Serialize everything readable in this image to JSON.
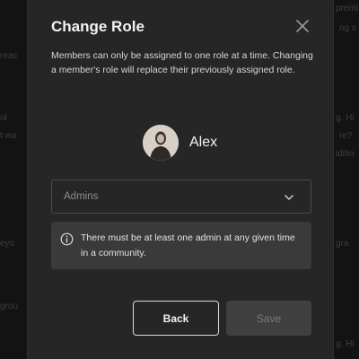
{
  "background": {
    "fragments": [
      {
        "text": "premi",
        "side": "right"
      },
      {
        "text": "ng s",
        "side": "right"
      },
      {
        "text": "reac",
        "side": "left"
      },
      {
        "text": "ol",
        "side": "left"
      },
      {
        "text": "t wa",
        "side": "left"
      },
      {
        "text": "g. Hi",
        "side": "right"
      },
      {
        "text": "re?",
        "side": "right"
      },
      {
        "text": "iditio",
        "side": "right"
      },
      {
        "text": "eyo",
        "side": "left"
      },
      {
        "text": "gra",
        "side": "right"
      },
      {
        "text": "grou",
        "side": "left"
      },
      {
        "text": "g. Hi",
        "side": "right"
      }
    ]
  },
  "modal": {
    "title": "Change Role",
    "description": "Members can only be assigned to one role at a time. Changing a member's role will replace their previously assigned role.",
    "member": {
      "name": "Alex"
    },
    "role_select": {
      "value": "Admins"
    },
    "notice": {
      "text": "There must be at least one admin at any given time in a community."
    },
    "buttons": {
      "back": "Back",
      "save": "Save"
    }
  },
  "colors": {
    "modal_bg": "#262626",
    "notice_bg": "#3a3a3a",
    "disabled_button_bg": "#404040"
  },
  "icons": [
    "close-icon",
    "chevron-down-icon",
    "info-icon"
  ]
}
